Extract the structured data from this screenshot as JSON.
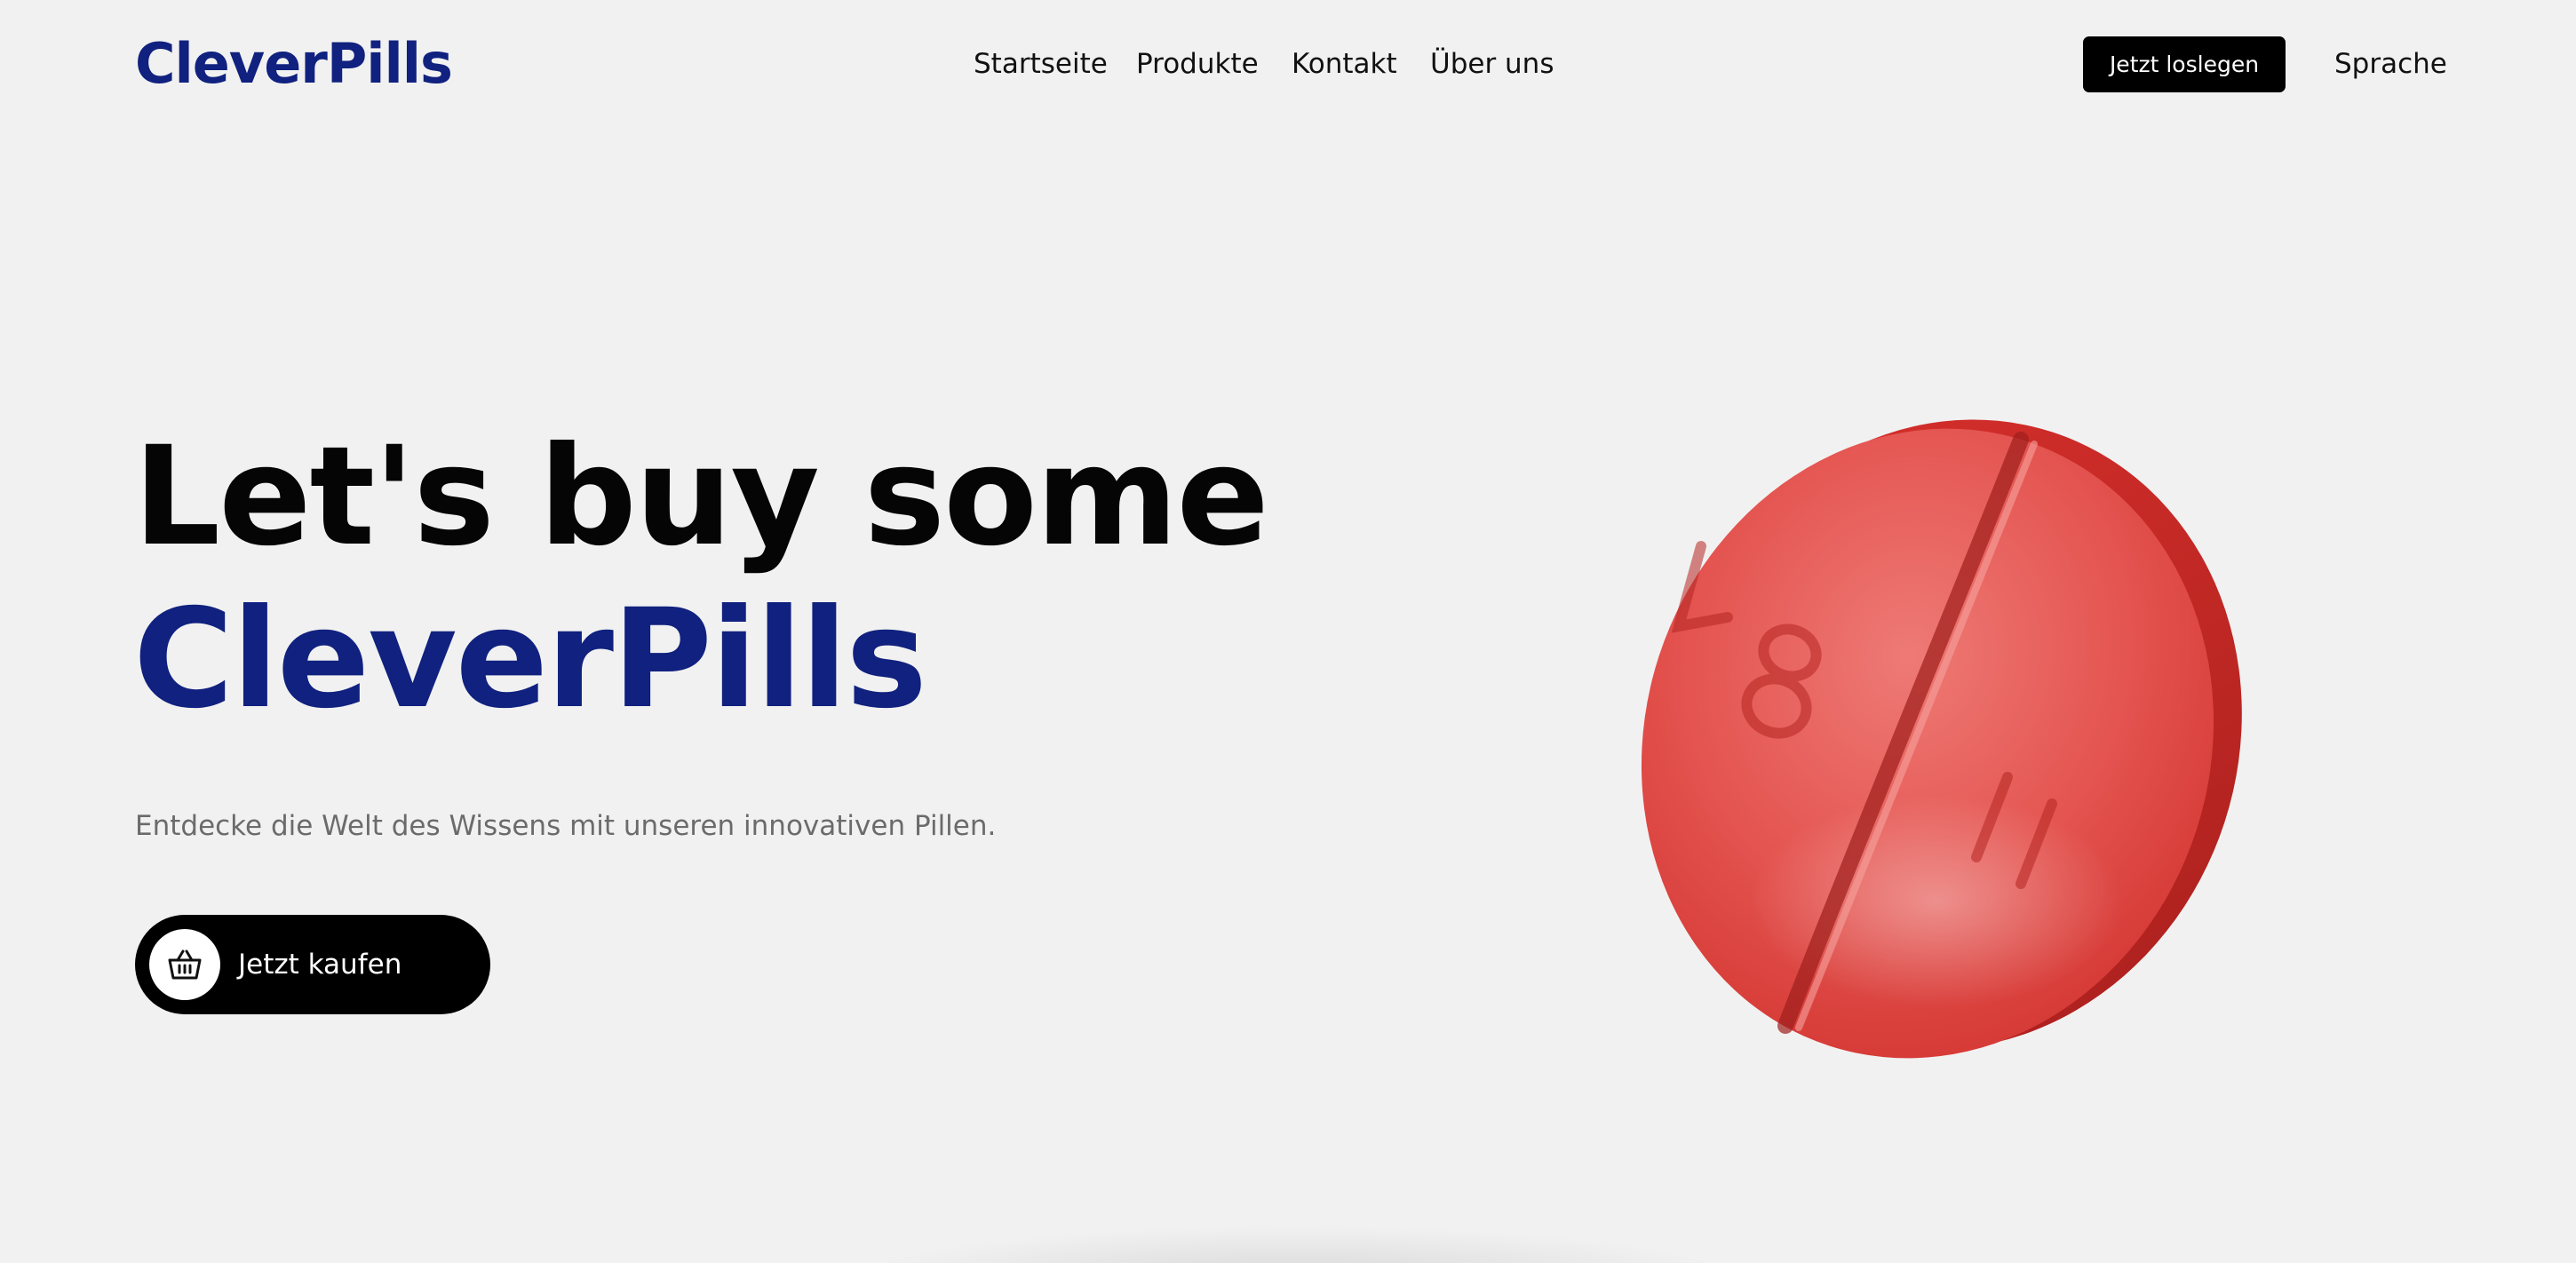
{
  "header": {
    "logo": "CleverPills",
    "nav": [
      {
        "label": "Startseite"
      },
      {
        "label": "Produkte"
      },
      {
        "label": "Kontakt"
      },
      {
        "label": "Über uns"
      }
    ],
    "cta_label": "Jetzt loslegen",
    "language_label": "Sprache"
  },
  "hero": {
    "title_line1": "Let's buy some",
    "title_line2": "CleverPills",
    "subtitle": "Entdecke die Welt des Wissens mit unseren innovativen Pillen.",
    "buy_button_label": "Jetzt kaufen",
    "buy_icon": "shopping-basket-icon"
  },
  "colors": {
    "brand_blue": "#10217f",
    "background": "#f1f1f1",
    "button_black": "#000000",
    "pill_red": "#d93230"
  }
}
